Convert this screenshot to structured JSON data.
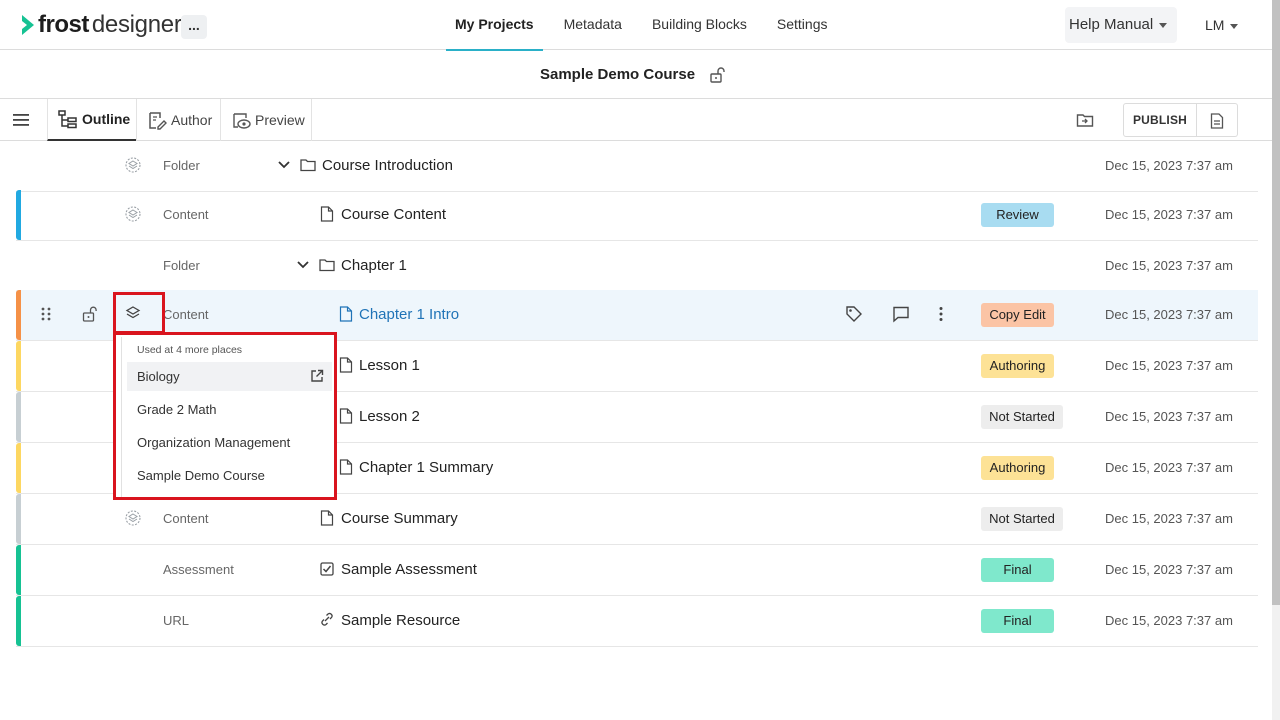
{
  "header": {
    "logo_strong": "frost",
    "logo_light": "designer",
    "more_label": "...",
    "nav": [
      "My Projects",
      "Metadata",
      "Building Blocks",
      "Settings"
    ],
    "help_label": "Help Manual",
    "user_initials": "LM"
  },
  "course": {
    "title": "Sample Demo Course"
  },
  "toolbar": {
    "tabs": [
      "Outline",
      "Author",
      "Preview"
    ],
    "publish_label": "PUBLISH"
  },
  "colors": {
    "accent_underline": "#2ab0c8",
    "link": "#1f73b7",
    "review_badge": "#a8dcf1",
    "copy_edit_badge": "#fbc4a5",
    "authoring_badge": "#fde296",
    "not_started_badge": "#ededed",
    "final_badge": "#7fe8cc",
    "bar_blue": "#21a9e1",
    "bar_orange": "#f59147",
    "bar_yellow": "#fdd761",
    "bar_grey": "#c7cfd3",
    "bar_green": "#16c293",
    "highlight_red": "#d9141e"
  },
  "rows": [
    {
      "type": "Folder",
      "name": "Course Introduction",
      "icon": "folder-icon",
      "status": "",
      "date": "Dec 15, 2023 7:37 am"
    },
    {
      "type": "Content",
      "name": "Course Content",
      "icon": "document-icon",
      "status": "Review",
      "date": "Dec 15, 2023 7:37 am"
    },
    {
      "type": "Folder",
      "name": "Chapter 1",
      "icon": "folder-icon",
      "status": "",
      "date": "Dec 15, 2023 7:37 am"
    },
    {
      "type": "Content",
      "name": "Chapter 1 Intro",
      "icon": "document-icon",
      "status": "Copy Edit",
      "date": "Dec 15, 2023 7:37 am"
    },
    {
      "type": "",
      "name": "Lesson 1",
      "icon": "document-icon",
      "status": "Authoring",
      "date": "Dec 15, 2023 7:37 am"
    },
    {
      "type": "",
      "name": "Lesson 2",
      "icon": "document-icon",
      "status": "Not Started",
      "date": "Dec 15, 2023 7:37 am"
    },
    {
      "type": "",
      "name": "Chapter 1 Summary",
      "icon": "document-icon",
      "status": "Authoring",
      "date": "Dec 15, 2023 7:37 am"
    },
    {
      "type": "Content",
      "name": "Course Summary",
      "icon": "document-icon",
      "status": "Not Started",
      "date": "Dec 15, 2023 7:37 am"
    },
    {
      "type": "Assessment",
      "name": "Sample Assessment",
      "icon": "checkbox-icon",
      "status": "Final",
      "date": "Dec 15, 2023 7:37 am"
    },
    {
      "type": "URL",
      "name": "Sample Resource",
      "icon": "link-icon",
      "status": "Final",
      "date": "Dec 15, 2023 7:37 am"
    }
  ],
  "popup": {
    "heading": "Used at 4 more places",
    "items": [
      "Biology",
      "Grade 2 Math",
      "Organization Management",
      "Sample Demo Course"
    ]
  }
}
